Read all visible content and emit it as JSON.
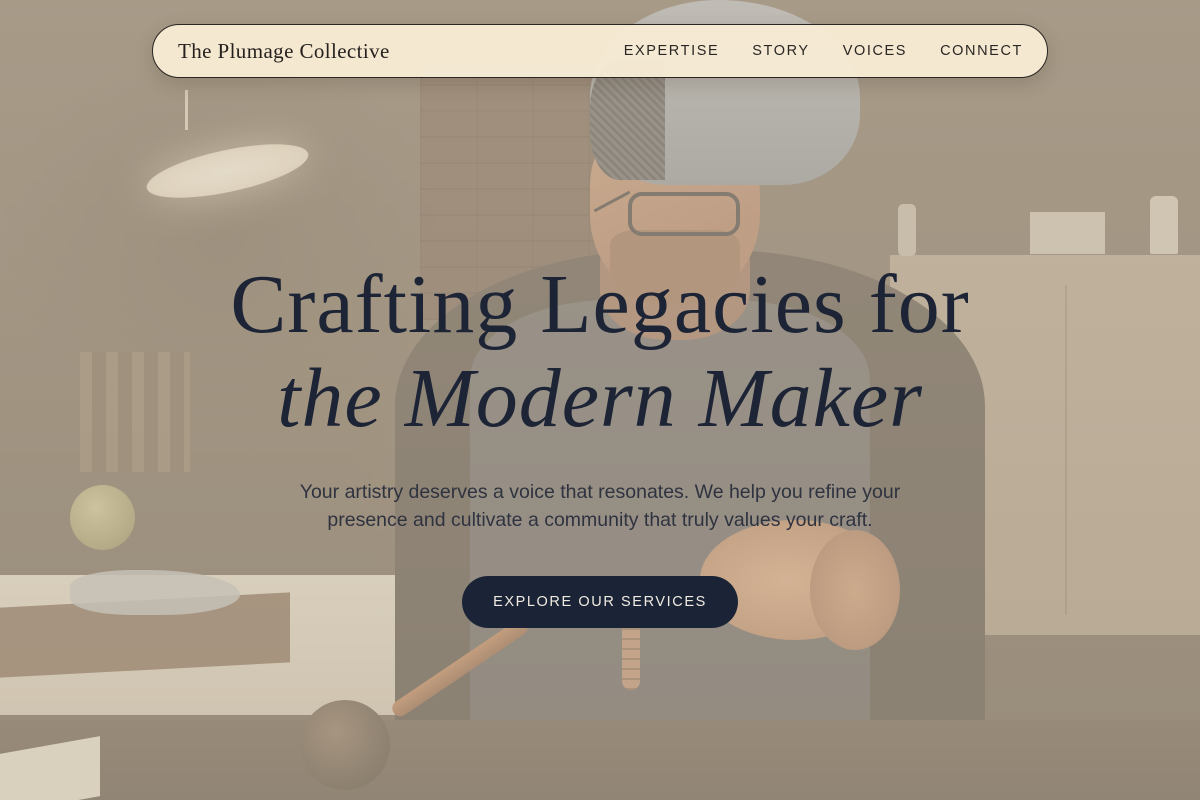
{
  "nav": {
    "brand": "The Plumage Collective",
    "links": [
      "EXPERTISE",
      "STORY",
      "VOICES",
      "CONNECT"
    ]
  },
  "hero": {
    "headline_line1": "Crafting Legacies for",
    "headline_line2": "the Modern Maker",
    "subtext": "Your artistry deserves a voice that resonates. We help you refine your presence and cultivate a community that truly values your craft.",
    "cta_label": "EXPLORE OUR SERVICES"
  },
  "colors": {
    "navy": "#1b2437",
    "nav_bg": "#f7ebd4",
    "overlay": "#d0c2ac"
  }
}
